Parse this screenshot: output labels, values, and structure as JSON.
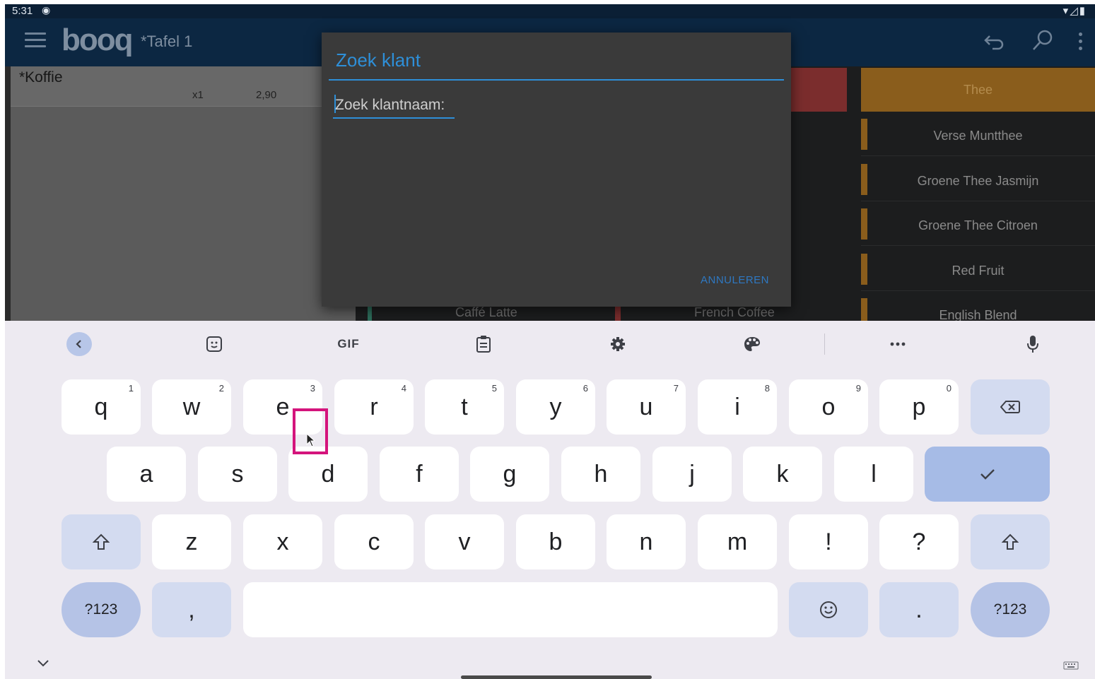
{
  "status_bar": {
    "time": "5:31"
  },
  "app_bar": {
    "logo": "booq",
    "table_title": "*Tafel 1"
  },
  "order": {
    "item_name": "*Koffie",
    "quantity": "x1",
    "price": "2,90"
  },
  "products": {
    "category": "Thee",
    "items": [
      "Verse Muntthee",
      "Groene Thee Jasmijn",
      "Groene Thee Citroen",
      "Red Fruit",
      "English Blend"
    ],
    "bottom_row": [
      "Caffé Latte",
      "French Coffee"
    ]
  },
  "dialog": {
    "title": "Zoek klant",
    "search_label": "Zoek klantnaam:",
    "cancel_label": "ANNULEREN"
  },
  "keyboard": {
    "toolbar": {
      "gif": "GIF"
    },
    "row1": [
      {
        "label": "q",
        "hint": "1"
      },
      {
        "label": "w",
        "hint": "2"
      },
      {
        "label": "e",
        "hint": "3"
      },
      {
        "label": "r",
        "hint": "4"
      },
      {
        "label": "t",
        "hint": "5"
      },
      {
        "label": "y",
        "hint": "6"
      },
      {
        "label": "u",
        "hint": "7"
      },
      {
        "label": "i",
        "hint": "8"
      },
      {
        "label": "o",
        "hint": "9"
      },
      {
        "label": "p",
        "hint": "0"
      }
    ],
    "row2": [
      "a",
      "s",
      "d",
      "f",
      "g",
      "h",
      "j",
      "k",
      "l"
    ],
    "row3": [
      "z",
      "x",
      "c",
      "v",
      "b",
      "n",
      "m",
      "!",
      "?"
    ],
    "symbols_label": "?123",
    "comma": ",",
    "period": "."
  },
  "colors": {
    "accent": "#2e8fd8",
    "highlight": "#d4147c",
    "thee_category": "#8a5d1c"
  }
}
